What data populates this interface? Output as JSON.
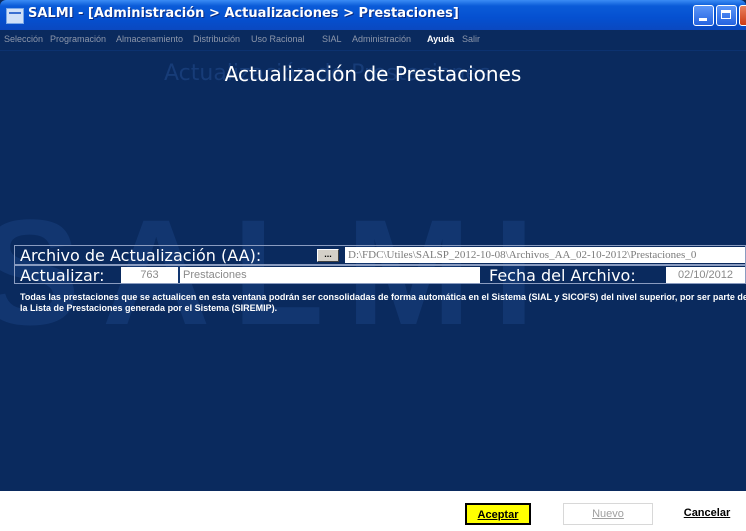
{
  "window": {
    "title": "SALMI - [Administración > Actualizaciones > Prestaciones]"
  },
  "menu": [
    {
      "label": "Selección",
      "active": false
    },
    {
      "label": "Programación",
      "active": false
    },
    {
      "label": "Almacenamiento",
      "active": false
    },
    {
      "label": "Distribución",
      "active": false
    },
    {
      "label": "Uso Racional",
      "active": false
    },
    {
      "label": "SIAL",
      "active": false
    },
    {
      "label": "Administración",
      "active": false
    },
    {
      "label": "Ayuda",
      "active": true
    },
    {
      "label": "Salir",
      "active": false
    }
  ],
  "page": {
    "heading": "Actualización de Prestaciones",
    "watermark": "SALMI"
  },
  "archivo": {
    "label": "Archivo de Actualización (AA):",
    "browse_label": "...",
    "path": "D:\\FDC\\Utiles\\SALSP_2012-10-08\\Archivos_AA_02-10-2012\\Prestaciones_0"
  },
  "actualizar": {
    "label": "Actualizar:",
    "count": "763",
    "name": "Prestaciones",
    "fecha_label": "Fecha del Archivo:",
    "fecha": "02/10/2012"
  },
  "description": "Todas las prestaciones que se actualicen en esta ventana  podrán ser consolidadas de forma automática en el Sistema (SIAL y SICOFS) del nivel superior, por  ser parte de la Lista de Prestaciones generada por el Sistema (SIREMIP).",
  "buttons": {
    "accept": "Aceptar",
    "new": "Nuevo",
    "cancel": "Cancelar"
  }
}
